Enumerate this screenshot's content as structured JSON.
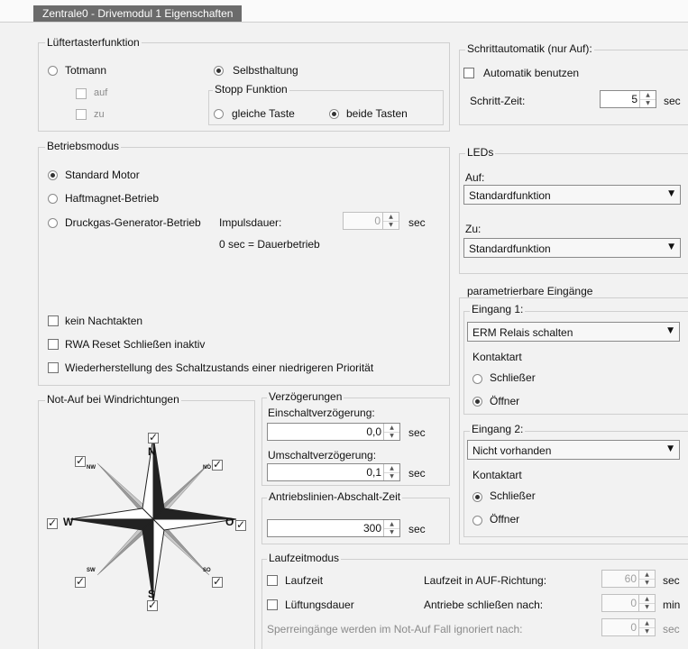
{
  "window": {
    "title": "Zentrale0 - Drivemodul 1 Eigenschaften"
  },
  "lueftertaster": {
    "group": "Lüftertasterfunktion",
    "totmann": "Totmann",
    "auf": "auf",
    "zu": "zu",
    "selbsthaltung": "Selbsthaltung",
    "stopp_group": "Stopp Funktion",
    "gleiche_taste": "gleiche Taste",
    "beide_tasten": "beide Tasten"
  },
  "schrittautomatik": {
    "group": "Schrittautomatik (nur Auf):",
    "benutzen": "Automatik benutzen",
    "zeit_label": "Schritt-Zeit:",
    "zeit_value": "5",
    "unit": "sec"
  },
  "betriebsmodus": {
    "group": "Betriebsmodus",
    "standard": "Standard Motor",
    "haftmagnet": "Haftmagnet-Betrieb",
    "druckgas": "Druckgas-Generator-Betrieb",
    "impuls_label": "Impulsdauer:",
    "impuls_value": "0",
    "unit": "sec",
    "hint": "0 sec = Dauerbetrieb",
    "kein_nachtakten": "kein Nachtakten",
    "rwa_reset": "RWA Reset Schließen inaktiv",
    "wiederherstellung": "Wiederherstellung des Schaltzustands einer niedrigeren Priorität"
  },
  "leds": {
    "group": "LEDs",
    "auf_label": "Auf:",
    "auf_value": "Standardfunktion",
    "zu_label": "Zu:",
    "zu_value": "Standardfunktion"
  },
  "eingaenge": {
    "group": "parametrierbare Eingänge",
    "e1_group": "Eingang 1:",
    "e1_value": "ERM Relais schalten",
    "e1_kontaktart": "Kontaktart",
    "e1_schliesser": "Schließer",
    "e1_oeffner": "Öffner",
    "e2_group": "Eingang 2:",
    "e2_value": "Nicht vorhanden",
    "e2_kontaktart": "Kontaktart",
    "e2_schliesser": "Schließer",
    "e2_oeffner": "Öffner"
  },
  "wind": {
    "group": "Not-Auf bei Windrichtungen",
    "n": "N",
    "s": "S",
    "w": "W",
    "o": "O",
    "nw": "NW",
    "no": "NO",
    "sw": "SW",
    "so": "SO"
  },
  "verzoegerungen": {
    "group": "Verzögerungen",
    "ein_label": "Einschaltverzögerung:",
    "ein_value": "0,0",
    "um_label": "Umschaltverzögerung:",
    "um_value": "0,1",
    "unit": "sec"
  },
  "antriebslinien": {
    "group": "Antriebslinien-Abschalt-Zeit",
    "value": "300",
    "unit": "sec"
  },
  "laufzeitmodus": {
    "group": "Laufzeitmodus",
    "laufzeit": "Laufzeit",
    "lueftungsdauer": "Lüftungsdauer",
    "auf_richtung_label": "Laufzeit in AUF-Richtung:",
    "auf_richtung_value": "60",
    "auf_richtung_unit": "sec",
    "schliessen_label": "Antriebe schließen nach:",
    "schliessen_value": "0",
    "schliessen_unit": "min",
    "sperr_label": "Sperreingänge werden im Not-Auf Fall ignoriert nach:",
    "sperr_value": "0",
    "sperr_unit": "sec"
  },
  "icons": {
    "spin_up": "▲",
    "spin_down": "▼",
    "combo_arrow": "▼"
  }
}
